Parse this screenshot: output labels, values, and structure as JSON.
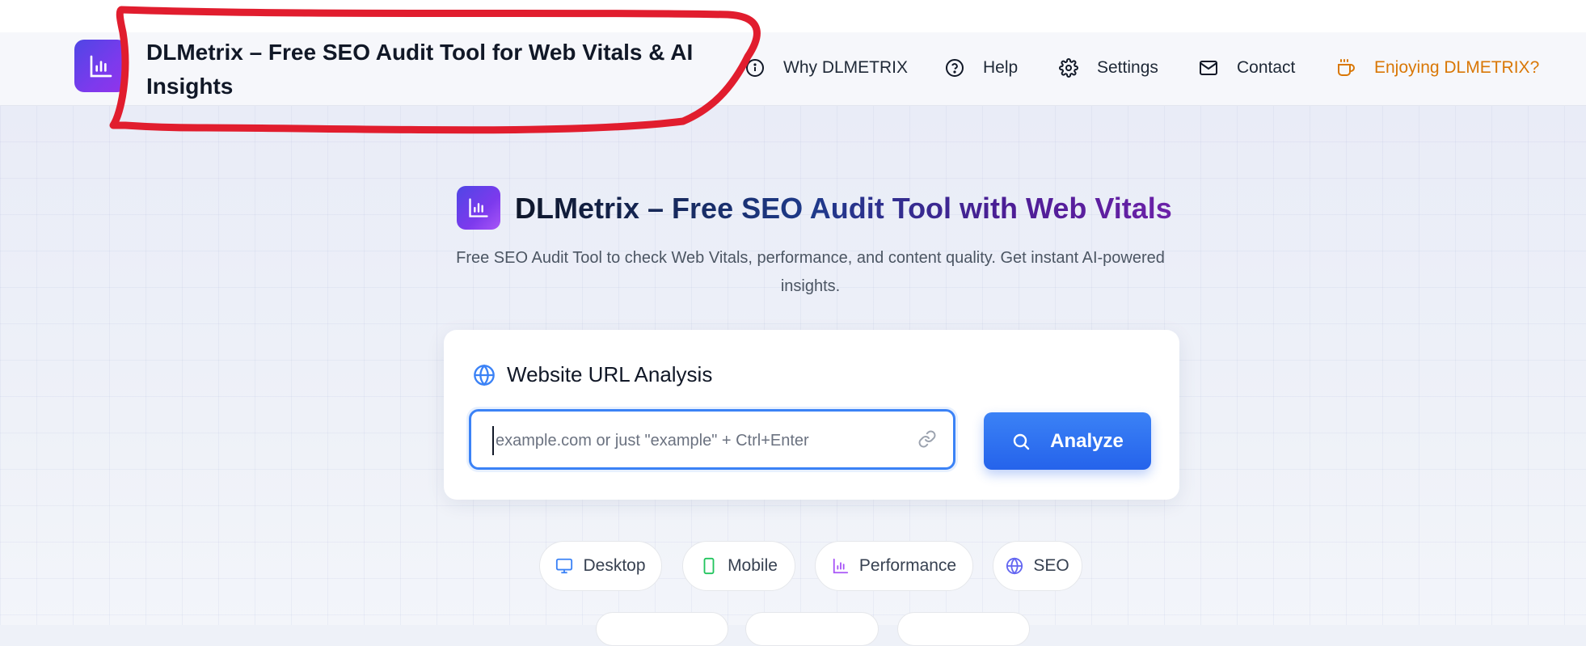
{
  "header": {
    "title": "DLMetrix – Free SEO Audit Tool for Web Vitals & AI Insights",
    "nav": [
      {
        "label": "Why DLMETRIX",
        "icon": "info-icon"
      },
      {
        "label": "Help",
        "icon": "help-circle-icon"
      },
      {
        "label": "Settings",
        "icon": "gear-icon"
      },
      {
        "label": "Contact",
        "icon": "mail-icon"
      },
      {
        "label": "Enjoying DLMETRIX?",
        "icon": "coffee-icon",
        "color": "#d97706"
      }
    ]
  },
  "hero": {
    "title": "DLMetrix – Free SEO Audit Tool with Web Vitals",
    "subtitle": "Free SEO Audit Tool to check Web Vitals, performance, and content quality. Get instant AI-powered insights."
  },
  "card": {
    "title": "Website URL Analysis",
    "input_placeholder": "example.com or just \"example\" + Ctrl+Enter",
    "input_value": "",
    "analyze_label": "Analyze"
  },
  "chips": [
    {
      "label": "Desktop",
      "icon": "monitor-icon",
      "color": "#3b82f6"
    },
    {
      "label": "Mobile",
      "icon": "smartphone-icon",
      "color": "#22c55e"
    },
    {
      "label": "Performance",
      "icon": "bar-chart-icon",
      "color": "#a855f7"
    },
    {
      "label": "SEO",
      "icon": "globe-icon",
      "color": "#6366f1"
    }
  ],
  "colors": {
    "accent": "#3b82f6",
    "brand_gradient_start": "#4f46e5",
    "brand_gradient_end": "#9333ea",
    "annotation": "#e11d2e"
  }
}
